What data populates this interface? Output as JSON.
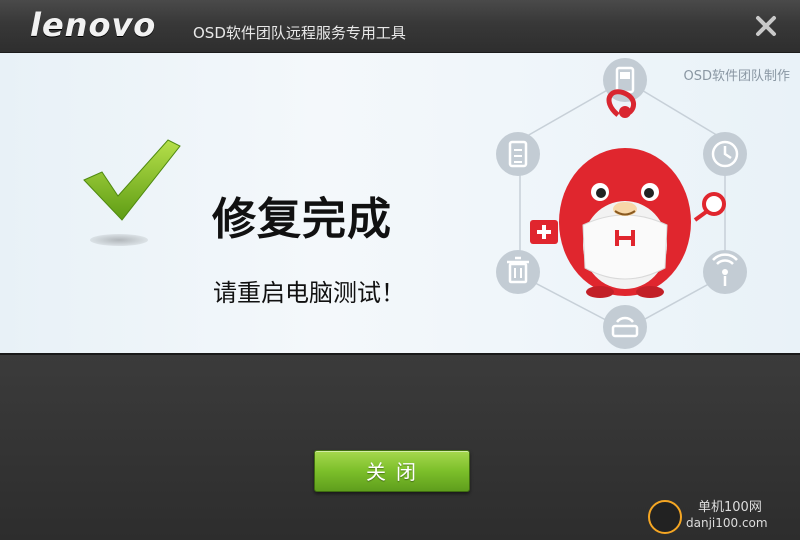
{
  "titlebar": {
    "logo": "lenovo",
    "title": "OSD软件团队远程服务专用工具"
  },
  "content": {
    "brand_note": "OSD软件团队制作",
    "headline": "修复完成",
    "subline": "请重启电脑测试！"
  },
  "mascot": {
    "icons": [
      "phone-icon",
      "clock-icon",
      "wifi-icon",
      "router-icon",
      "trash-icon",
      "clipboard-icon"
    ]
  },
  "footer": {
    "close_label": "关闭"
  },
  "watermark": {
    "line1": "单机100网",
    "line2": "danji100.com"
  },
  "colors": {
    "accent_green": "#7cbf2a",
    "mascot_red": "#e0262e",
    "icon_gray": "#b9c3cc"
  }
}
